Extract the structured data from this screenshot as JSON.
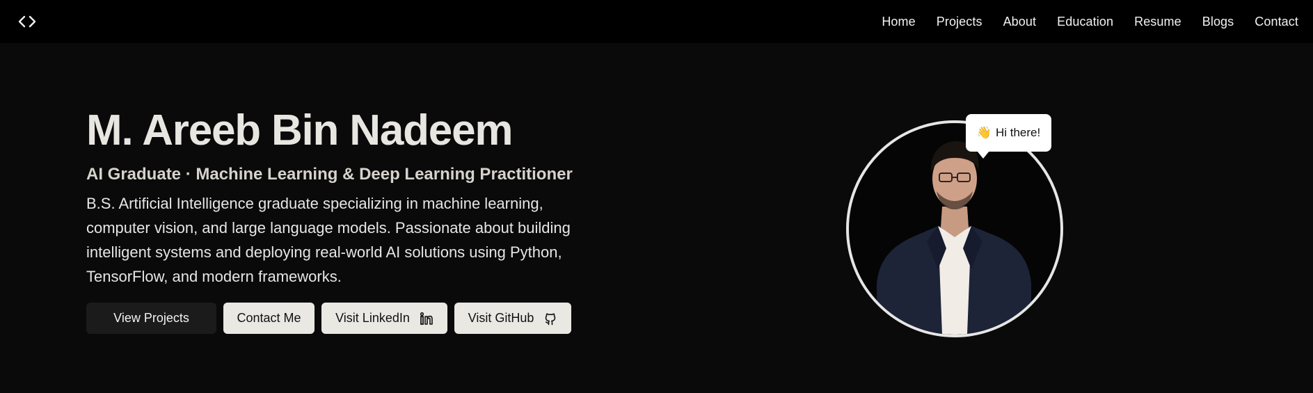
{
  "nav": {
    "logo_icon": "code-brackets-icon",
    "links": [
      {
        "label": "Home"
      },
      {
        "label": "Projects"
      },
      {
        "label": "About"
      },
      {
        "label": "Education"
      },
      {
        "label": "Resume"
      },
      {
        "label": "Blogs"
      },
      {
        "label": "Contact"
      }
    ]
  },
  "hero": {
    "name": "M. Areeb Bin Nadeem",
    "subtitle": "AI Graduate · Machine Learning & Deep Learning Practitioner",
    "description": "B.S. Artificial Intelligence graduate specializing in machine learning, computer vision, and large language models. Passionate about building intelligent systems and deploying real-world AI solutions using Python, TensorFlow, and modern frameworks.",
    "buttons": {
      "view_projects": "View Projects",
      "contact_me": "Contact Me",
      "visit_linkedin": "Visit LinkedIn",
      "visit_github": "Visit GitHub"
    }
  },
  "portrait": {
    "bubble_emoji": "👋",
    "bubble_text": "Hi there!"
  },
  "colors": {
    "nav_bg": "#000000",
    "page_bg": "#0a0a0a",
    "heading": "#e8e6e1",
    "button_light": "#e9e8e3",
    "button_dark": "#1b1b1b",
    "portrait_ring": "#e6e6e6"
  }
}
